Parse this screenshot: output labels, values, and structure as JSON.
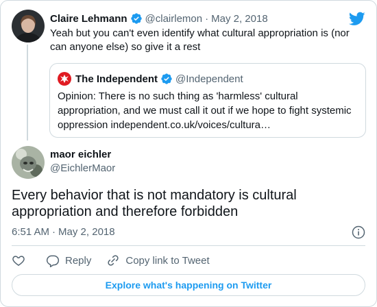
{
  "parent_tweet": {
    "name": "Claire Lehmann",
    "handle": "@clairlemon",
    "separator": "·",
    "date": "May 2, 2018",
    "text": "Yeah but you can't even identify what cultural appropriation is (nor can anyone else) so give it a rest"
  },
  "quoted_tweet": {
    "name": "The Independent",
    "handle": "@Independent",
    "text": "Opinion: There is no such thing as 'harmless' cultural appropriation, and we must call it out if we hope to fight systemic oppression independent.co.uk/voices/cultura…"
  },
  "main_tweet": {
    "name": "maor eichler",
    "handle": "@EichlerMaor",
    "text": "Every behavior that is not mandatory is cultural appropriation and therefore forbidden",
    "time": "6:51 AM",
    "separator": "·",
    "date": "May 2, 2018"
  },
  "actions": {
    "reply_label": "Reply",
    "copy_link_label": "Copy link to Tweet"
  },
  "explore_label": "Explore what's happening on Twitter",
  "icons": [
    "twitter-bird-icon",
    "verified-badge-icon",
    "info-icon",
    "heart-icon",
    "reply-icon",
    "link-icon"
  ],
  "colors": {
    "accent": "#1d9bf0",
    "text": "#0f1419",
    "secondary": "#536471",
    "border": "#cfd9de",
    "independent_red": "#e01b22"
  }
}
